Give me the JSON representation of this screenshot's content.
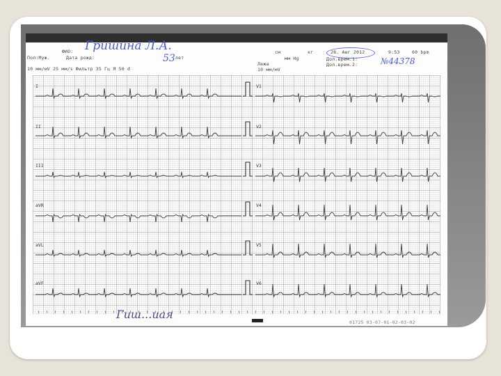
{
  "header": {
    "fio_label": "ФИО:",
    "sex_label": "Пол:Муж.",
    "dob_label": "Дата рожд:",
    "age_label": "лет",
    "speed_line": "10 мм/мV    25 мм/s   Фильтр 35 Гц   Я 50  d",
    "height_label": "см",
    "weight_label": "кг",
    "pressure_label": "мм Hg",
    "date": "28. Авг 2012",
    "time": "9:53",
    "rate": "60 bpm",
    "extra1": "Доп.врем.1:",
    "extra2": "Доп.врем.2:",
    "position": "Лежа",
    "gain_right": "10 мм/мV"
  },
  "handwriting": {
    "name": "Гришина Л.А.",
    "age": "53",
    "number": "№44378",
    "signature": "Гиш...иая"
  },
  "leads": {
    "left": [
      "I",
      "II",
      "III",
      "aVR",
      "aVL",
      "aVF"
    ],
    "right": [
      "V1",
      "V2",
      "V3",
      "V4",
      "V5",
      "V6"
    ]
  },
  "footer": {
    "code": "01725 03-07-01-02-03-02"
  }
}
